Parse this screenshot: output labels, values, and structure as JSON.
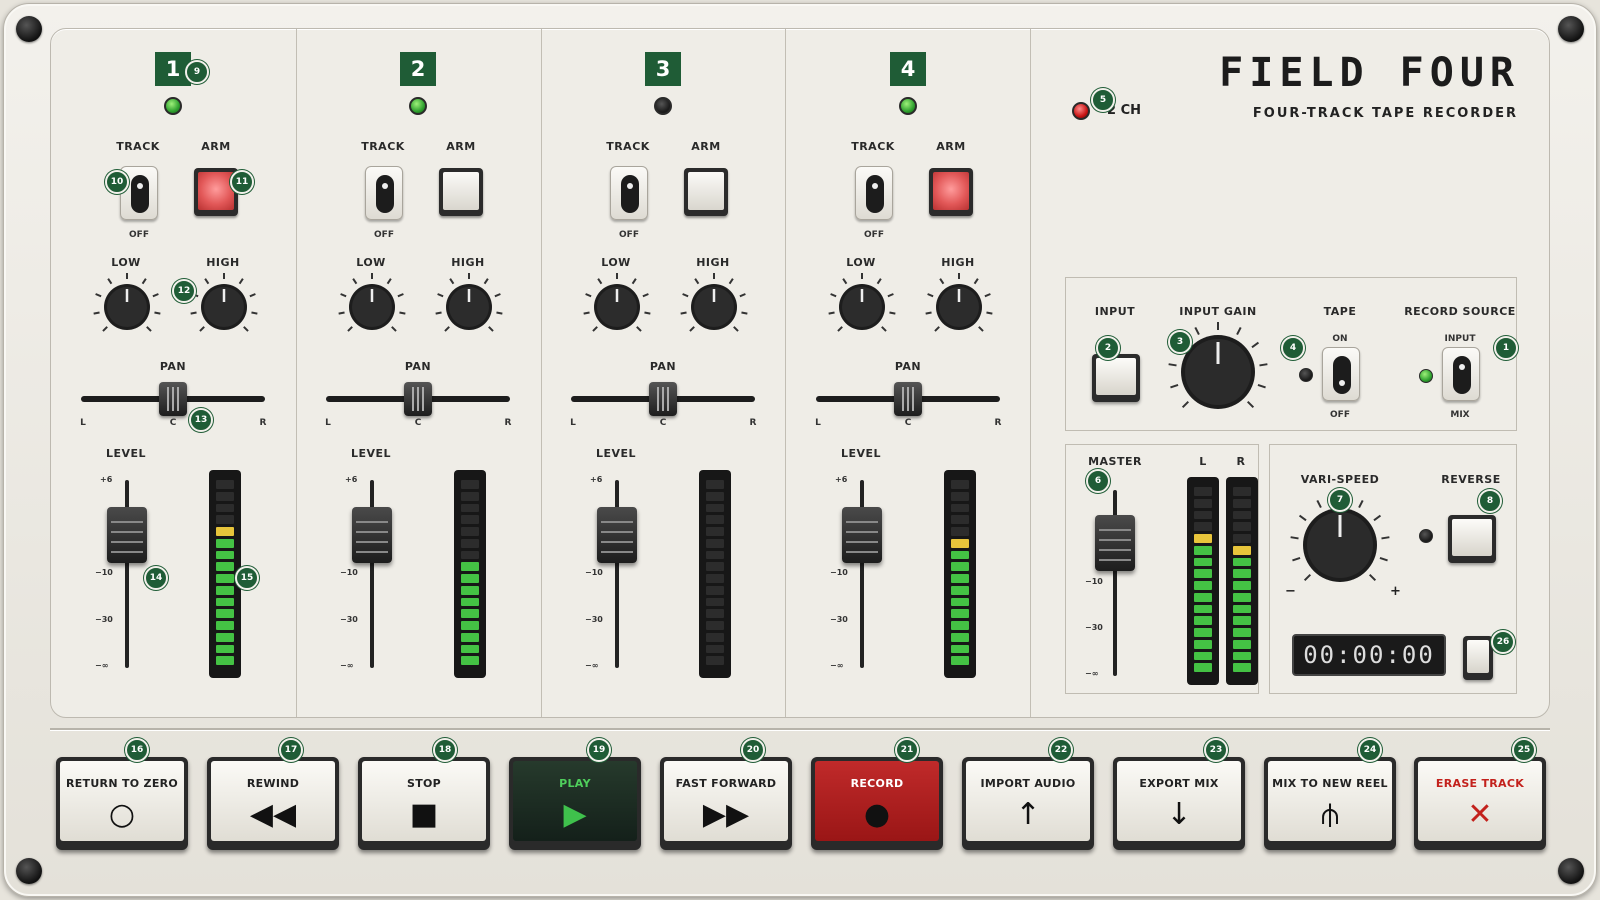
{
  "brand": {
    "title": "FIELD FOUR",
    "subtitle": "FOUR-TRACK TAPE RECORDER"
  },
  "channels": [
    {
      "number": "1",
      "active_led": true,
      "track_label": "TRACK",
      "off_label": "OFF",
      "arm_label": "ARM",
      "armed": true,
      "low_label": "LOW",
      "high_label": "HIGH",
      "pan_label": "PAN",
      "pan_l": "L",
      "pan_c": "C",
      "pan_r": "R",
      "level_label": "LEVEL",
      "meter_lit": 12
    },
    {
      "number": "2",
      "active_led": true,
      "track_label": "TRACK",
      "off_label": "OFF",
      "arm_label": "ARM",
      "armed": false,
      "low_label": "LOW",
      "high_label": "HIGH",
      "pan_label": "PAN",
      "pan_l": "L",
      "pan_c": "C",
      "pan_r": "R",
      "level_label": "LEVEL",
      "meter_lit": 9
    },
    {
      "number": "3",
      "active_led": false,
      "track_label": "TRACK",
      "off_label": "OFF",
      "arm_label": "ARM",
      "armed": false,
      "low_label": "LOW",
      "high_label": "HIGH",
      "pan_label": "PAN",
      "pan_l": "L",
      "pan_c": "C",
      "pan_r": "R",
      "level_label": "LEVEL",
      "meter_lit": 0
    },
    {
      "number": "4",
      "active_led": true,
      "track_label": "TRACK",
      "off_label": "OFF",
      "arm_label": "ARM",
      "armed": true,
      "low_label": "LOW",
      "high_label": "HIGH",
      "pan_label": "PAN",
      "pan_l": "L",
      "pan_c": "C",
      "pan_r": "R",
      "level_label": "LEVEL",
      "meter_lit": 11
    }
  ],
  "fader_scale": {
    "plus6": "+6",
    "minus10": "−10",
    "minus30": "−30",
    "minus_inf": "−∞"
  },
  "two_ch": {
    "label": "2 CH"
  },
  "input_section": {
    "input_label": "INPUT",
    "gain_label": "INPUT GAIN",
    "tape_label": "TAPE",
    "tape_on": "ON",
    "tape_off": "OFF",
    "record_source_label": "RECORD SOURCE",
    "record_source_input": "INPUT",
    "record_source_mix": "MIX"
  },
  "master": {
    "label": "MASTER",
    "left": "L",
    "right": "R",
    "meter_left_lit": 12,
    "meter_right_lit": 11
  },
  "varispeed": {
    "label": "VARI-SPEED",
    "minus": "−",
    "plus": "+",
    "reverse_label": "REVERSE"
  },
  "counter": {
    "value": "00:00:00"
  },
  "transport": [
    {
      "label": "RETURN TO ZERO",
      "icon": "○",
      "icon_name": "circle-icon",
      "style": ""
    },
    {
      "label": "REWIND",
      "icon": "◀◀",
      "icon_name": "rewind-icon",
      "style": ""
    },
    {
      "label": "STOP",
      "icon": "■",
      "icon_name": "stop-icon",
      "style": ""
    },
    {
      "label": "PLAY",
      "icon": "▶",
      "icon_name": "play-icon",
      "style": "play"
    },
    {
      "label": "FAST FORWARD",
      "icon": "▶▶",
      "icon_name": "fast-forward-icon",
      "style": ""
    },
    {
      "label": "RECORD",
      "icon": "●",
      "icon_name": "record-icon",
      "style": "rec"
    },
    {
      "label": "IMPORT AUDIO",
      "icon": "↑",
      "icon_name": "arrow-up-icon",
      "style": ""
    },
    {
      "label": "EXPORT MIX",
      "icon": "↓",
      "icon_name": "arrow-down-icon",
      "style": ""
    },
    {
      "label": "MIX TO NEW REEL",
      "icon": "⫛",
      "icon_name": "fork-icon",
      "style": ""
    },
    {
      "label": "ERASE TRACK",
      "icon": "✕",
      "icon_name": "close-icon",
      "style": "erase"
    }
  ],
  "badges": [
    "1",
    "2",
    "3",
    "4",
    "5",
    "6",
    "7",
    "8",
    "9",
    "10",
    "11",
    "12",
    "13",
    "14",
    "15",
    "16",
    "17",
    "18",
    "19",
    "20",
    "21",
    "22",
    "23",
    "24",
    "25",
    "26"
  ]
}
